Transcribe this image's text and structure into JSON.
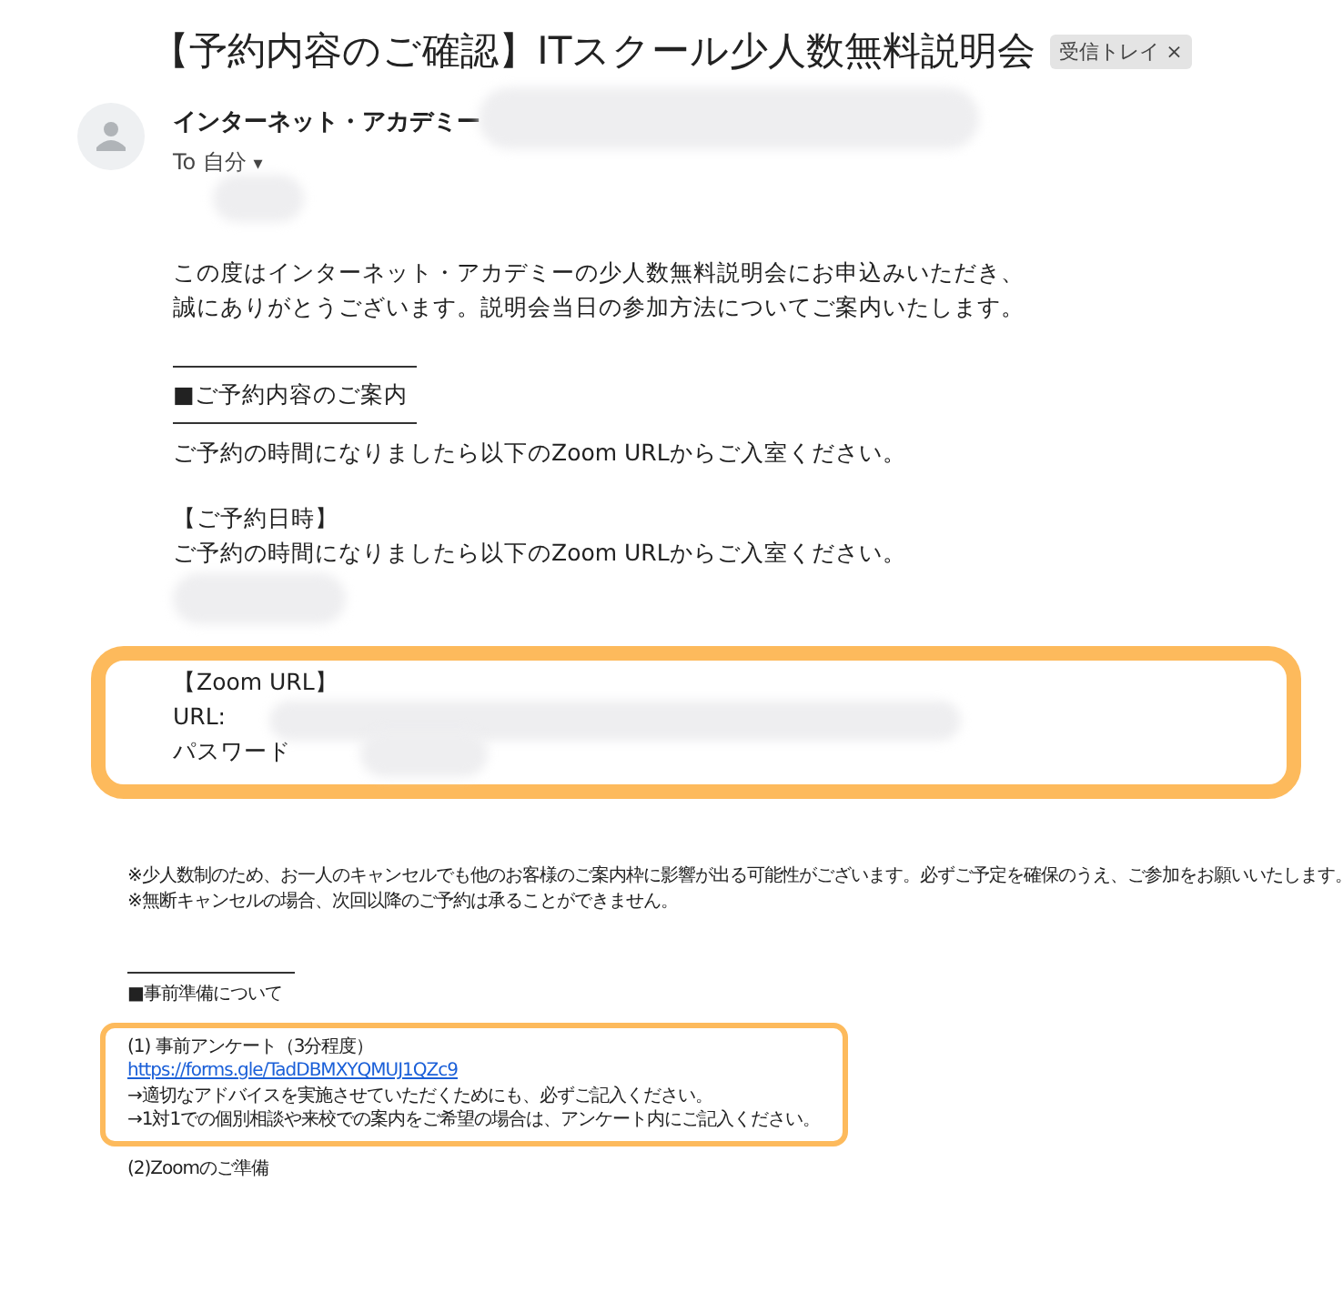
{
  "subject": "【予約内容のご確認】ITスクール少人数無料説明会",
  "label": {
    "text": "受信トレイ",
    "close": "×"
  },
  "sender": "インターネット・アカデミー",
  "recipient": {
    "to": "To 自分",
    "caret": "▾"
  },
  "intro": [
    "この度はインターネット・アカデミーの少人数無料説明会にお申込みいただき、",
    "誠にありがとうございます。説明会当日の参加方法についてご案内いたします。"
  ],
  "section": {
    "heading": "■ご予約内容のご案内",
    "lines": [
      "ご予約の時間になりましたら以下のZoom URLからご入室ください。"
    ]
  },
  "reservation": {
    "heading": "【ご予約日時】",
    "line": "ご予約の時間になりましたら以下のZoom URLからご入室ください。"
  },
  "zoom_box": {
    "heading": "【Zoom URL】",
    "url_label": "URL:",
    "password_label": "パスワード"
  },
  "notes": [
    "※少人数制のため、お一人のキャンセルでも他のお客様のご案内枠に影響が出る可能性がございます。必ずご予定を確保のうえ、ご参加をお願いいたします。",
    "※無断キャンセルの場合、次回以降のご予約は承ることができません。"
  ],
  "prep": {
    "heading": "■事前準備について",
    "survey": {
      "title": "(1) 事前アンケート（3分程度）",
      "link": "https://forms.gle/TadDBMXYQMUJ1QZc9",
      "notes": [
        "→適切なアドバイスを実施させていただくためにも、必ずご記入ください。",
        "→1対1での個別相談や来校での案内をご希望の場合は、アンケート内にご記入ください。"
      ]
    },
    "next": "(2)Zoomのご準備"
  }
}
